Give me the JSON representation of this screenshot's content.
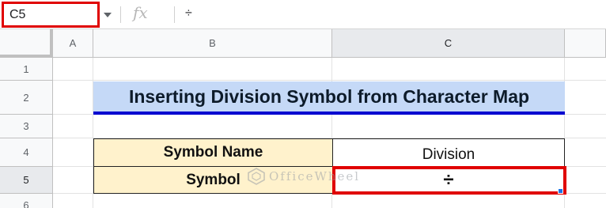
{
  "formula_bar": {
    "name_box": "C5",
    "fx_label": "fx",
    "formula": "÷"
  },
  "columns": [
    "A",
    "B",
    "C"
  ],
  "rows": [
    "1",
    "2",
    "3",
    "4",
    "5",
    "6"
  ],
  "sheet": {
    "title": "Inserting Division Symbol from Character Map",
    "table": [
      {
        "label": "Symbol Name",
        "value": "Division"
      },
      {
        "label": "Symbol",
        "value": "÷"
      }
    ],
    "selected_cell": "C5"
  },
  "watermark": "OfficeWheel",
  "colors": {
    "title_fill": "#c5d9f7",
    "title_underline": "#0000d0",
    "header_fill": "#fff2cc",
    "highlight": "#e00000",
    "fill_handle": "#1a73e8"
  }
}
